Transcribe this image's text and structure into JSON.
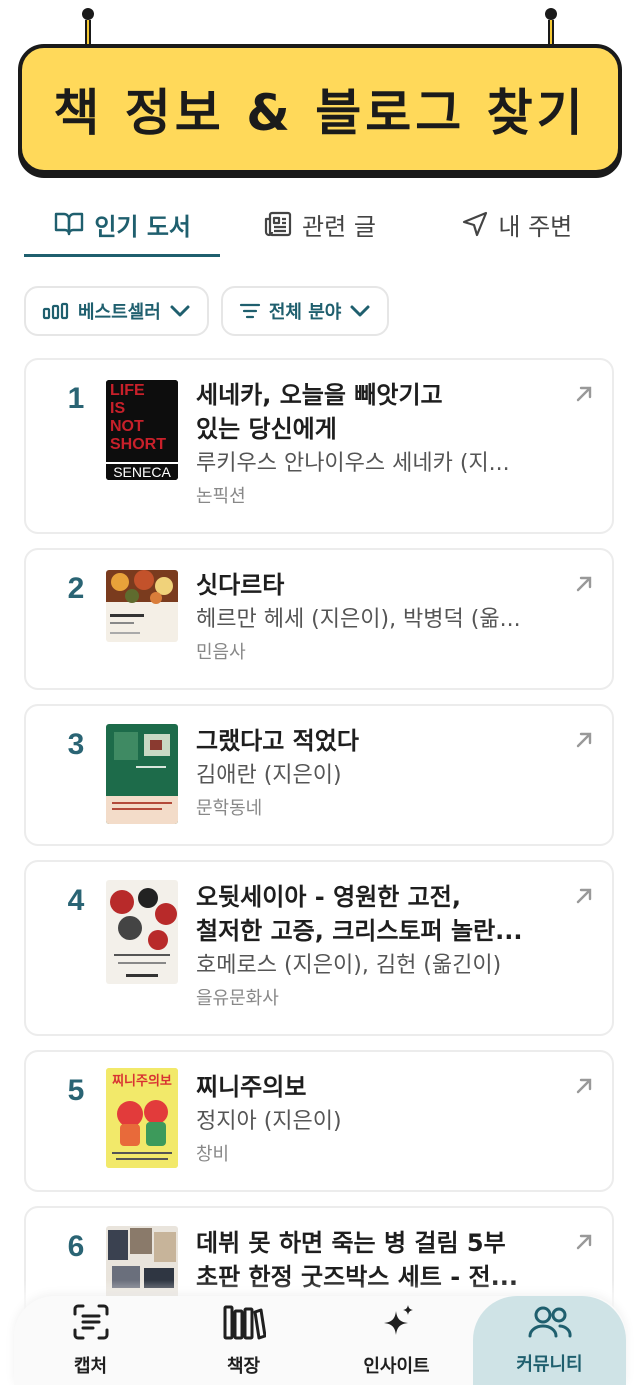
{
  "header": {
    "title": "책 정보 & 블로그 찾기"
  },
  "tabs": [
    {
      "label": "인기 도서",
      "icon": "book-open-icon",
      "active": true
    },
    {
      "label": "관련 글",
      "icon": "newspaper-icon",
      "active": false
    },
    {
      "label": "내 주변",
      "icon": "navigation-icon",
      "active": false
    }
  ],
  "filters": {
    "sort": {
      "label": "베스트셀러",
      "icon": "bar-chart-icon"
    },
    "category": {
      "label": "전체 분야",
      "icon": "filter-icon"
    }
  },
  "books": [
    {
      "rank": "1",
      "title": "세네카, 오늘을 빼앗기고\n있는 당신에게",
      "author": "루키우스 안나이우스 세네카 (지...",
      "publisher": "논픽션"
    },
    {
      "rank": "2",
      "title": "싯다르타",
      "author": "헤르만 헤세 (지은이), 박병덕 (옮...",
      "publisher": "민음사"
    },
    {
      "rank": "3",
      "title": "그랬다고 적었다",
      "author": "김애란 (지은이)",
      "publisher": "문학동네"
    },
    {
      "rank": "4",
      "title": "오뒷세이아 - 영원한 고전,\n철저한 고증, 크리스토퍼 놀란...",
      "author": "호메로스 (지은이), 김헌 (옮긴이)",
      "publisher": "을유문화사"
    },
    {
      "rank": "5",
      "title": "찌니주의보",
      "author": "정지아 (지은이)",
      "publisher": "창비"
    },
    {
      "rank": "6",
      "title": "데뷔 못 하면 죽는 병 걸림 5부\n초판 한정 굿즈박스 세트 - 전...",
      "author": "",
      "publisher": ""
    }
  ],
  "covers": {
    "book1": {
      "line1": "LIFE",
      "line2": "IS",
      "line3": "NOT",
      "line4": "SHORT",
      "line5": "SENECA"
    },
    "book5": {
      "text": "찌니주의보"
    }
  },
  "bottom_nav": [
    {
      "label": "캡처",
      "icon": "scan-text-icon",
      "active": false
    },
    {
      "label": "책장",
      "icon": "bookshelf-icon",
      "active": false
    },
    {
      "label": "인사이트",
      "icon": "sparkles-icon",
      "active": false
    },
    {
      "label": "커뮤니티",
      "icon": "users-icon",
      "active": true
    }
  ],
  "colors": {
    "accent": "#1f5f6e",
    "banner": "#ffd95a",
    "nav_active": "#cfe3e6"
  }
}
